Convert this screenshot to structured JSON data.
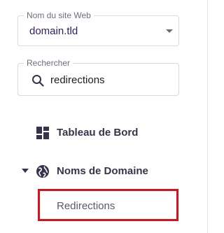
{
  "site_select": {
    "legend": "Nom du site Web",
    "value": "domain.tld"
  },
  "search": {
    "legend": "Rechercher",
    "value": "redirections"
  },
  "nav": {
    "dashboard": {
      "label": "Tableau de Bord",
      "icon": "dashboard-icon"
    },
    "domains": {
      "label": "Noms de Domaine",
      "icon": "globe-icon",
      "expanded": true,
      "children": [
        {
          "label": "Redirections",
          "highlighted": true
        }
      ]
    }
  },
  "colors": {
    "highlight_border": "#d8111a",
    "nav_text": "#36344d",
    "select_text": "#2f1c6a"
  }
}
